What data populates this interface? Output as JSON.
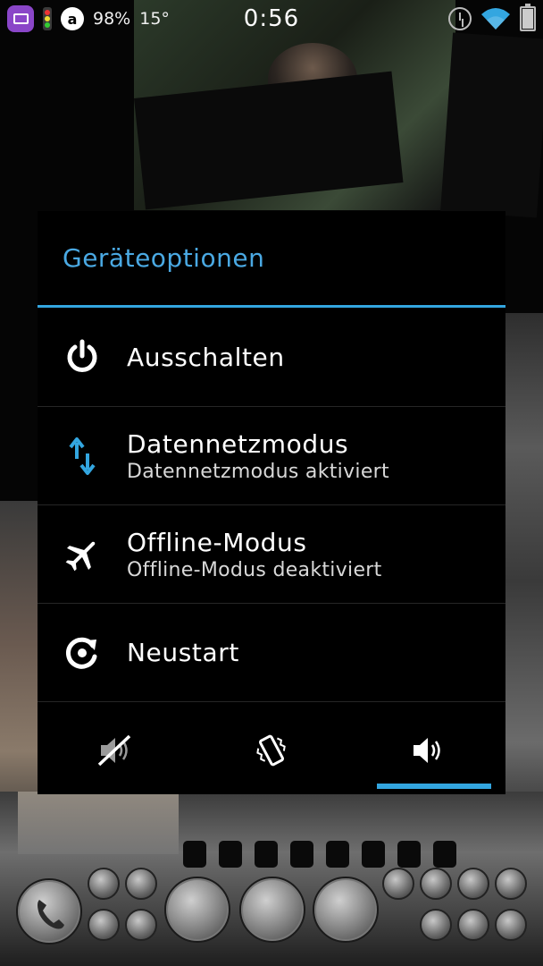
{
  "status_bar": {
    "battery_percent": "98%",
    "temperature": "15°",
    "clock": "0:56",
    "icons": [
      "app-launcher-icon",
      "traffic-light-icon",
      "a-circle-icon",
      "alarm-icon",
      "wifi-icon",
      "battery-icon"
    ]
  },
  "dialog": {
    "title": "Geräteoptionen",
    "accent_color": "#33a6e0",
    "items": [
      {
        "icon": "power-icon",
        "title": "Ausschalten",
        "subtitle": ""
      },
      {
        "icon": "data-transfer-icon",
        "title": "Datennetzmodus",
        "subtitle": "Datennetzmodus aktiviert"
      },
      {
        "icon": "airplane-icon",
        "title": "Offline-Modus",
        "subtitle": "Offline-Modus deaktiviert"
      },
      {
        "icon": "restart-icon",
        "title": "Neustart",
        "subtitle": ""
      }
    ],
    "sound_modes": [
      {
        "icon": "sound-muted-icon",
        "selected": false
      },
      {
        "icon": "vibrate-icon",
        "selected": false
      },
      {
        "icon": "sound-on-icon",
        "selected": true
      }
    ]
  }
}
